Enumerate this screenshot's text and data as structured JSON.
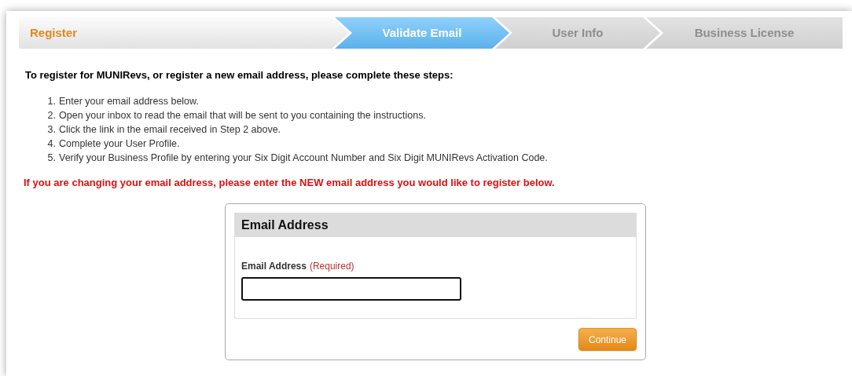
{
  "steps": [
    {
      "label": "Register",
      "completed": true,
      "selected": false
    },
    {
      "label": "Validate Email",
      "completed": false,
      "selected": true
    },
    {
      "label": "User Info",
      "completed": false,
      "selected": false
    },
    {
      "label": "Business License",
      "completed": false,
      "selected": false
    }
  ],
  "intro": "To register for MUNIRevs, or register a new email address, please complete these steps:",
  "instructions": [
    {
      "number": "1.",
      "text": "Enter your email address below."
    },
    {
      "number": "2.",
      "text": "Open your inbox to read the email that will be sent to you containing the instructions."
    },
    {
      "number": "3.",
      "text": "Click the link in the email received in Step 2 above."
    },
    {
      "number": "4.",
      "text": "Complete your User Profile."
    },
    {
      "number": "5.",
      "text": "Verify your Business Profile by entering your Six Digit Account Number and Six Digit MUNIRevs Activation Code."
    }
  ],
  "warning": "If you are changing your email address, please enter the NEW email address you would like to register below.",
  "form": {
    "title": "Email Address",
    "field_label": "Email Address",
    "required_note": "(Required)",
    "button": "Continue"
  }
}
